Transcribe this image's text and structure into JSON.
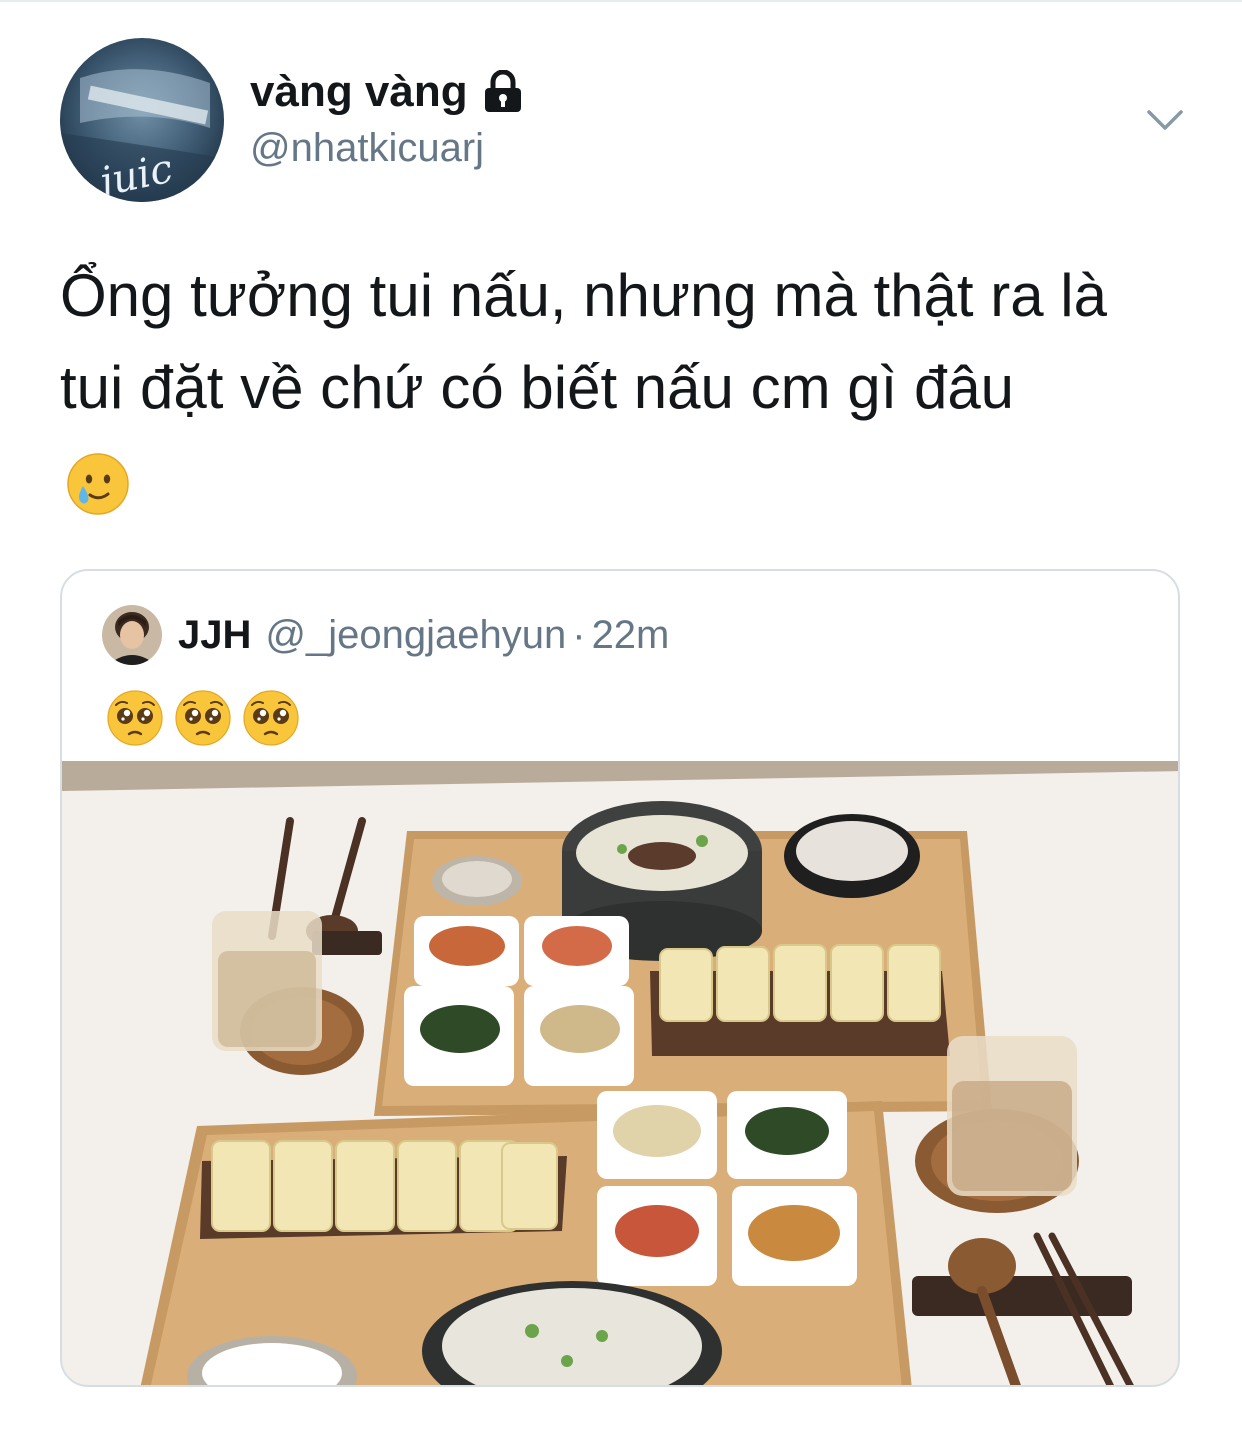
{
  "tweet": {
    "display_name": "vàng vàng",
    "handle": "@nhatkicuarj",
    "avatar_text": "juic",
    "text_line1": "Ổng tưởng tui nấu, nhưng mà thật ra là",
    "text_line2": "tui đặt về chứ có biết nấu cm gì đâu",
    "trailing_emoji": "face-holding-back-tears"
  },
  "quoted_tweet": {
    "name": "JJH",
    "handle": "@_jeongjaehyun",
    "separator": "·",
    "time": "22m",
    "emojis": [
      "pleading-face",
      "pleading-face",
      "pleading-face"
    ]
  },
  "colors": {
    "text_primary": "#14171a",
    "text_secondary": "#657786",
    "border": "#d7dee3",
    "emoji_yellow": "#f9c63b"
  }
}
